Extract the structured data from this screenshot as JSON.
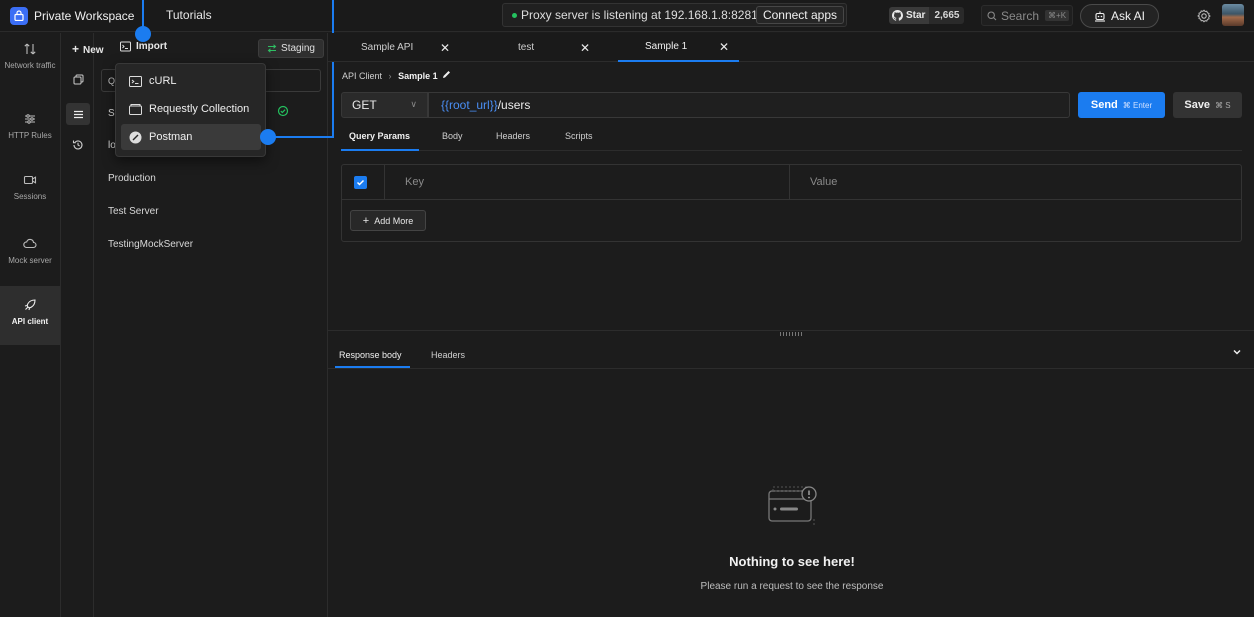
{
  "topbar": {
    "workspace": "Private Workspace",
    "tutorials": "Tutorials",
    "proxy_status": "Proxy server is listening at 192.168.1.8:8281",
    "connect_apps": "Connect apps",
    "github_star": "Star",
    "github_count": "2,665",
    "search_placeholder": "Search",
    "search_shortcut": "⌘+K",
    "ask_ai": "Ask AI"
  },
  "leftnav": [
    {
      "label": "Network traffic",
      "icon": "arrows-updown-icon"
    },
    {
      "label": "HTTP Rules",
      "icon": "sliders-icon"
    },
    {
      "label": "Sessions",
      "icon": "video-icon"
    },
    {
      "label": "Mock server",
      "icon": "cloud-icon"
    },
    {
      "label": "API client",
      "icon": "rocket-icon",
      "active": true
    }
  ],
  "panel": {
    "new_label": "New",
    "import_label": "Import",
    "staging_label": "Staging",
    "env_items": [
      "Production",
      "Test Server",
      "TestingMockServer"
    ]
  },
  "dropdown": {
    "items": [
      "cURL",
      "Requestly Collection",
      "Postman"
    ]
  },
  "tabs": [
    {
      "label": "Sample API"
    },
    {
      "label": "test"
    },
    {
      "label": "Sample 1",
      "active": true
    }
  ],
  "breadcrumb": {
    "root": "API Client",
    "current": "Sample 1"
  },
  "request": {
    "method": "GET",
    "url_var": "{{root_url}}",
    "url_path": "/users",
    "send_label": "Send",
    "send_shortcut": "⌘ Enter",
    "save_label": "Save",
    "save_shortcut": "⌘ S"
  },
  "subtabs": [
    "Query Params",
    "Body",
    "Headers",
    "Scripts"
  ],
  "params": {
    "key_placeholder": "Key",
    "value_placeholder": "Value",
    "add_more": "Add More"
  },
  "response": {
    "tabs": [
      "Response body",
      "Headers"
    ],
    "empty_title": "Nothing to see here!",
    "empty_subtitle": "Please run a request to see the response"
  },
  "colors": {
    "accent": "#1b7cf0",
    "bg": "#1c1c1c",
    "status_green": "#24c25f"
  }
}
